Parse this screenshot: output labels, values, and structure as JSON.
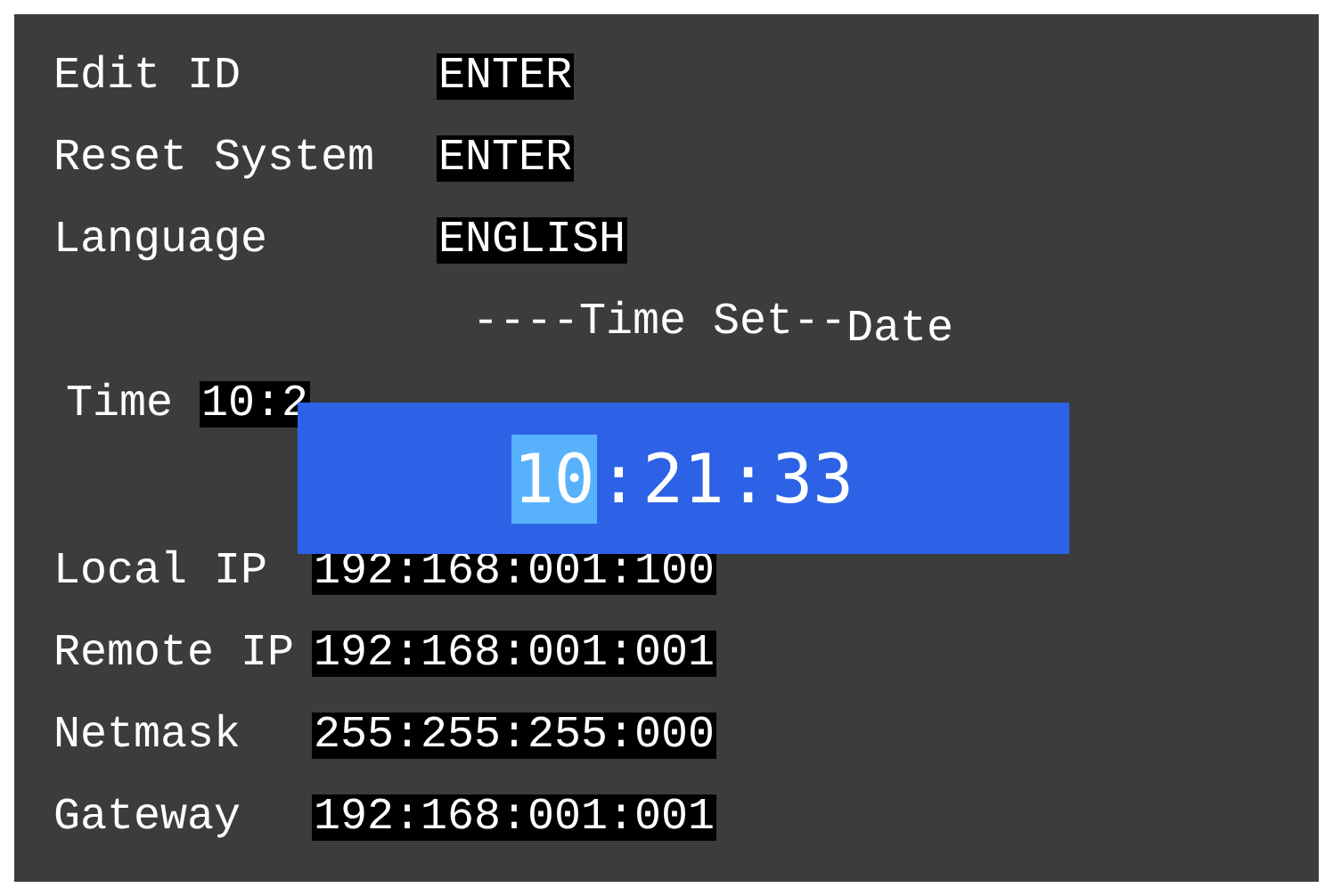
{
  "settings": [
    {
      "label": "Edit ID",
      "value": "ENTER"
    },
    {
      "label": "Reset System",
      "value": "ENTER"
    },
    {
      "label": "Language",
      "value": "ENGLISH"
    }
  ],
  "time_set": {
    "heading": "----Time Set--",
    "heading_end": "Date",
    "time_label": "Time",
    "time_value": "10:2"
  },
  "time_editor": {
    "segments": [
      {
        "kind": "field",
        "text": "10",
        "selected": true
      },
      {
        "kind": "separator",
        "text": ":"
      },
      {
        "kind": "field",
        "text": "21",
        "selected": false
      },
      {
        "kind": "separator",
        "text": ":"
      },
      {
        "kind": "field",
        "text": "33",
        "selected": false
      }
    ]
  },
  "network": [
    {
      "label": "Local IP",
      "value": "192:168:001:100"
    },
    {
      "label": "Remote IP",
      "value": "192:168:001:001"
    },
    {
      "label": "Netmask",
      "value": "255:255:255:000"
    },
    {
      "label": "Gateway",
      "value": "192:168:001:001"
    }
  ]
}
